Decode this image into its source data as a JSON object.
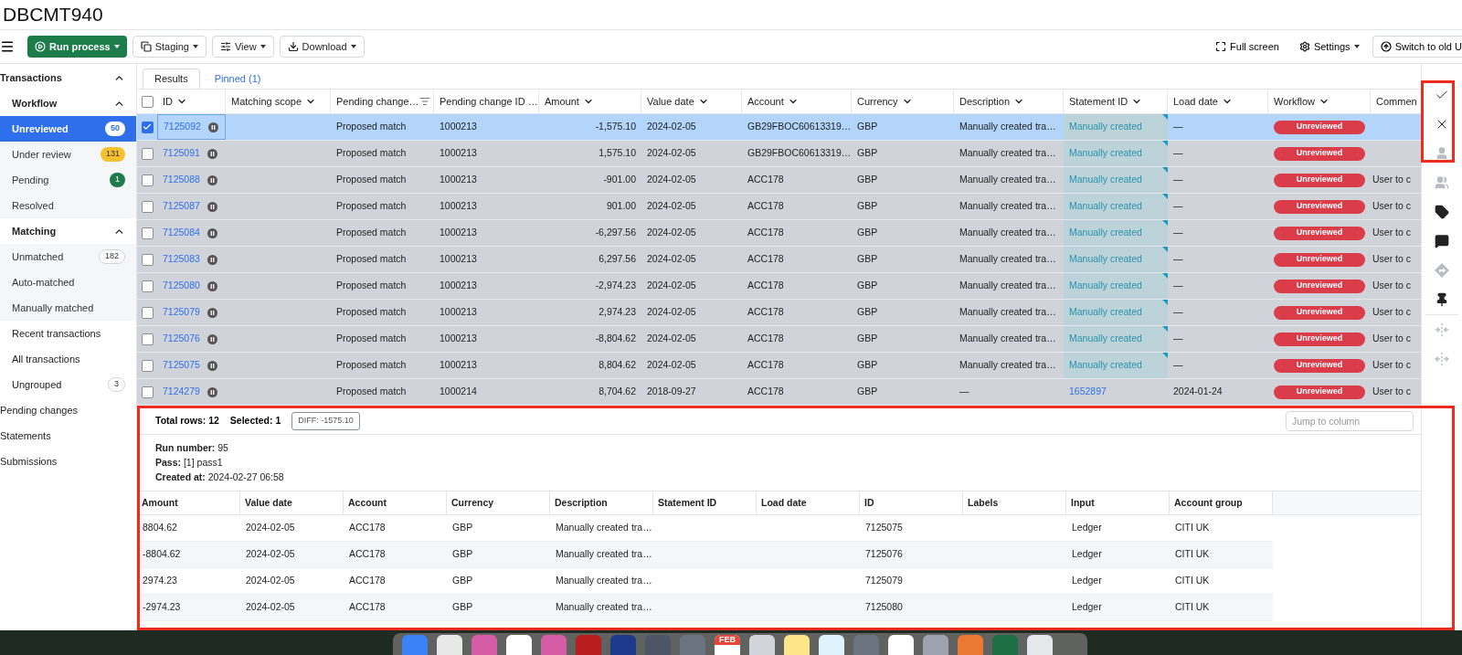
{
  "title": "DBCMT940",
  "toolbar": {
    "buttons": [
      {
        "label": "Run process",
        "kind": "primary"
      },
      {
        "label": "Staging",
        "kind": "staging"
      },
      {
        "label": "View",
        "kind": "view"
      },
      {
        "label": "Download",
        "kind": "download"
      }
    ],
    "right": [
      {
        "label": "Full screen",
        "kind": "fullscreen"
      },
      {
        "label": "Settings",
        "kind": "settings"
      },
      {
        "label": "Switch to old U",
        "kind": "switch"
      }
    ]
  },
  "sidebar": [
    {
      "label": "Transactions",
      "expanded": true,
      "selected": false,
      "children": [
        {
          "label": "Workflow",
          "expanded": true,
          "selected": false,
          "children": [
            {
              "label": "Unreviewed",
              "badge": "50",
              "color": "#ffffff",
              "selected": true
            },
            {
              "label": "Under review",
              "badge": "131",
              "color": "#f6c02e",
              "selected": false
            },
            {
              "label": "Pending",
              "badge": "1",
              "color": "#1f7a4c",
              "selected": false
            },
            {
              "label": "Resolved",
              "selected": false
            }
          ]
        },
        {
          "label": "Matching",
          "expanded": true,
          "selected": false,
          "children": [
            {
              "label": "Unmatched",
              "badge": "182",
              "color": "#ffffff",
              "selected": false
            },
            {
              "label": "Auto-matched",
              "selected": false
            },
            {
              "label": "Manually matched",
              "selected": false
            }
          ]
        },
        {
          "label": "Recent transactions",
          "selected": false
        },
        {
          "label": "All transactions",
          "selected": false
        },
        {
          "label": "Ungrouped",
          "badge": "3",
          "color": "#ffffff",
          "selected": false
        }
      ]
    },
    {
      "label": "Pending changes",
      "selected": false
    },
    {
      "label": "Statements",
      "selected": false
    },
    {
      "label": "Submissions",
      "selected": false
    }
  ],
  "tabs": [
    {
      "label": "Results",
      "selected": true
    },
    {
      "label": "Pinned (1)",
      "selected": false
    }
  ],
  "table": {
    "all_checked": false,
    "columns": [
      {
        "label": "ID",
        "kind": "sortable"
      },
      {
        "label": "Matching scope",
        "kind": "sortable"
      },
      {
        "label": "Pending change…",
        "kind": "filtered"
      },
      {
        "label": "Pending change ID …",
        "kind": "plain"
      },
      {
        "label": "Amount",
        "kind": "sortable"
      },
      {
        "label": "Value date",
        "kind": "sortable"
      },
      {
        "label": "Account",
        "kind": "sortable"
      },
      {
        "label": "Currency",
        "kind": "sortable"
      },
      {
        "label": "Description",
        "kind": "sortable"
      },
      {
        "label": "Statement ID",
        "kind": "sortable"
      },
      {
        "label": "Load date",
        "kind": "sortable"
      },
      {
        "label": "Workflow",
        "kind": "sortable"
      },
      {
        "label": "Commen",
        "kind": "plain"
      }
    ],
    "rows": [
      {
        "selected": true,
        "checked": true,
        "id": "7125092",
        "pending_change": "Proposed match",
        "pending_change_id": "1000213",
        "amount": "-1,575.10",
        "value_date": "2024-02-05",
        "account": "GB29FBOC60613319…",
        "currency": "GBP",
        "description": "Manually created tra…",
        "statement": {
          "text": "Manually created",
          "kind": "note"
        },
        "load_date": "—",
        "workflow": "Unreviewed"
      },
      {
        "selected": false,
        "checked": false,
        "id": "7125091",
        "pending_change": "Proposed match",
        "pending_change_id": "1000213",
        "amount": "1,575.10",
        "value_date": "2024-02-05",
        "account": "GB29FBOC60613319…",
        "currency": "GBP",
        "description": "Manually created tra…",
        "statement": {
          "text": "Manually created",
          "kind": "note"
        },
        "load_date": "—",
        "workflow": "Unreviewed"
      },
      {
        "selected": false,
        "checked": false,
        "id": "7125088",
        "pending_change": "Proposed match",
        "pending_change_id": "1000213",
        "amount": "-901.00",
        "value_date": "2024-02-05",
        "account": "ACC178",
        "currency": "GBP",
        "description": "Manually created tra…",
        "statement": {
          "text": "Manually created",
          "kind": "note"
        },
        "load_date": "—",
        "workflow": "Unreviewed",
        "comment": "User to c"
      },
      {
        "selected": false,
        "checked": false,
        "id": "7125087",
        "pending_change": "Proposed match",
        "pending_change_id": "1000213",
        "amount": "901.00",
        "value_date": "2024-02-05",
        "account": "ACC178",
        "currency": "GBP",
        "description": "Manually created tra…",
        "statement": {
          "text": "Manually created",
          "kind": "note"
        },
        "load_date": "—",
        "workflow": "Unreviewed",
        "comment": "User to c"
      },
      {
        "selected": false,
        "checked": false,
        "id": "7125084",
        "pending_change": "Proposed match",
        "pending_change_id": "1000213",
        "amount": "-6,297.56",
        "value_date": "2024-02-05",
        "account": "ACC178",
        "currency": "GBP",
        "description": "Manually created tra…",
        "statement": {
          "text": "Manually created",
          "kind": "note"
        },
        "load_date": "—",
        "workflow": "Unreviewed",
        "comment": "User to c"
      },
      {
        "selected": false,
        "checked": false,
        "id": "7125083",
        "pending_change": "Proposed match",
        "pending_change_id": "1000213",
        "amount": "6,297.56",
        "value_date": "2024-02-05",
        "account": "ACC178",
        "currency": "GBP",
        "description": "Manually created tra…",
        "statement": {
          "text": "Manually created",
          "kind": "note"
        },
        "load_date": "—",
        "workflow": "Unreviewed",
        "comment": "User to c"
      },
      {
        "selected": false,
        "checked": false,
        "id": "7125080",
        "pending_change": "Proposed match",
        "pending_change_id": "1000213",
        "amount": "-2,974.23",
        "value_date": "2024-02-05",
        "account": "ACC178",
        "currency": "GBP",
        "description": "Manually created tra…",
        "statement": {
          "text": "Manually created",
          "kind": "note"
        },
        "load_date": "—",
        "workflow": "Unreviewed",
        "comment": "User to c"
      },
      {
        "selected": false,
        "checked": false,
        "id": "7125079",
        "pending_change": "Proposed match",
        "pending_change_id": "1000213",
        "amount": "2,974.23",
        "value_date": "2024-02-05",
        "account": "ACC178",
        "currency": "GBP",
        "description": "Manually created tra…",
        "statement": {
          "text": "Manually created",
          "kind": "note"
        },
        "load_date": "—",
        "workflow": "Unreviewed",
        "comment": "User to c"
      },
      {
        "selected": false,
        "checked": false,
        "id": "7125076",
        "pending_change": "Proposed match",
        "pending_change_id": "1000213",
        "amount": "-8,804.62",
        "value_date": "2024-02-05",
        "account": "ACC178",
        "currency": "GBP",
        "description": "Manually created tra…",
        "statement": {
          "text": "Manually created",
          "kind": "note"
        },
        "load_date": "—",
        "workflow": "Unreviewed",
        "comment": "User to c"
      },
      {
        "selected": false,
        "checked": false,
        "id": "7125075",
        "pending_change": "Proposed match",
        "pending_change_id": "1000213",
        "amount": "8,804.62",
        "value_date": "2024-02-05",
        "account": "ACC178",
        "currency": "GBP",
        "description": "Manually created tra…",
        "statement": {
          "text": "Manually created",
          "kind": "note"
        },
        "load_date": "—",
        "workflow": "Unreviewed",
        "comment": "User to c"
      },
      {
        "selected": false,
        "checked": false,
        "id": "7124279",
        "pending_change": "Proposed match",
        "pending_change_id": "1000214",
        "amount": "8,704.62",
        "value_date": "2018-09-27",
        "account": "ACC178",
        "currency": "GBP",
        "description": "—",
        "statement": {
          "text": "1652897",
          "kind": "link"
        },
        "load_date": "2024-01-24",
        "workflow": "Unreviewed",
        "comment": "User to c"
      }
    ]
  },
  "side_tools": [
    {
      "kind": "approve",
      "disabled": false
    },
    {
      "kind": "reject",
      "disabled": false
    },
    {
      "kind": "assign",
      "disabled": true
    },
    {
      "kind": "assign-group",
      "disabled": true
    },
    {
      "kind": "label",
      "disabled": false
    },
    {
      "kind": "comment",
      "disabled": false
    },
    {
      "kind": "forward",
      "disabled": true
    },
    {
      "kind": "pin",
      "disabled": false
    },
    {
      "kind": "shrink-columns",
      "disabled": true
    },
    {
      "kind": "expand-columns",
      "disabled": true
    }
  ],
  "details": {
    "total_rows": "Total rows: 12",
    "selected_count": "Selected: 1",
    "diff": "DIFF: -1575.10",
    "jump_placeholder": "Jump to column",
    "info": [
      "**Run number:** 95",
      "**Pass:** [1] pass1",
      "**Created at:** 2024-02-27 06:58"
    ],
    "columns": [
      "Amount",
      "Value date",
      "Account",
      "Currency",
      "Description",
      "Statement ID",
      "Load date",
      "ID",
      "Labels",
      "Input",
      "Account group"
    ],
    "rows": [
      {
        "amount": "8804.62",
        "value_date": "2024-02-05",
        "account": "ACC178",
        "currency": "GBP",
        "description": "Manually created tra…",
        "id": "7125075",
        "input": "Ledger",
        "account_group": "CITI UK"
      },
      {
        "amount": "-8804.62",
        "value_date": "2024-02-05",
        "account": "ACC178",
        "currency": "GBP",
        "description": "Manually created tra…",
        "id": "7125076",
        "input": "Ledger",
        "account_group": "CITI UK"
      },
      {
        "amount": "2974.23",
        "value_date": "2024-02-05",
        "account": "ACC178",
        "currency": "GBP",
        "description": "Manually created tra…",
        "id": "7125079",
        "input": "Ledger",
        "account_group": "CITI UK"
      },
      {
        "amount": "-2974.23",
        "value_date": "2024-02-05",
        "account": "ACC178",
        "currency": "GBP",
        "description": "Manually created tra…",
        "id": "7125080",
        "input": "Ledger",
        "account_group": "CITI UK"
      }
    ]
  },
  "dock": {
    "calendar_month": "FEB"
  }
}
